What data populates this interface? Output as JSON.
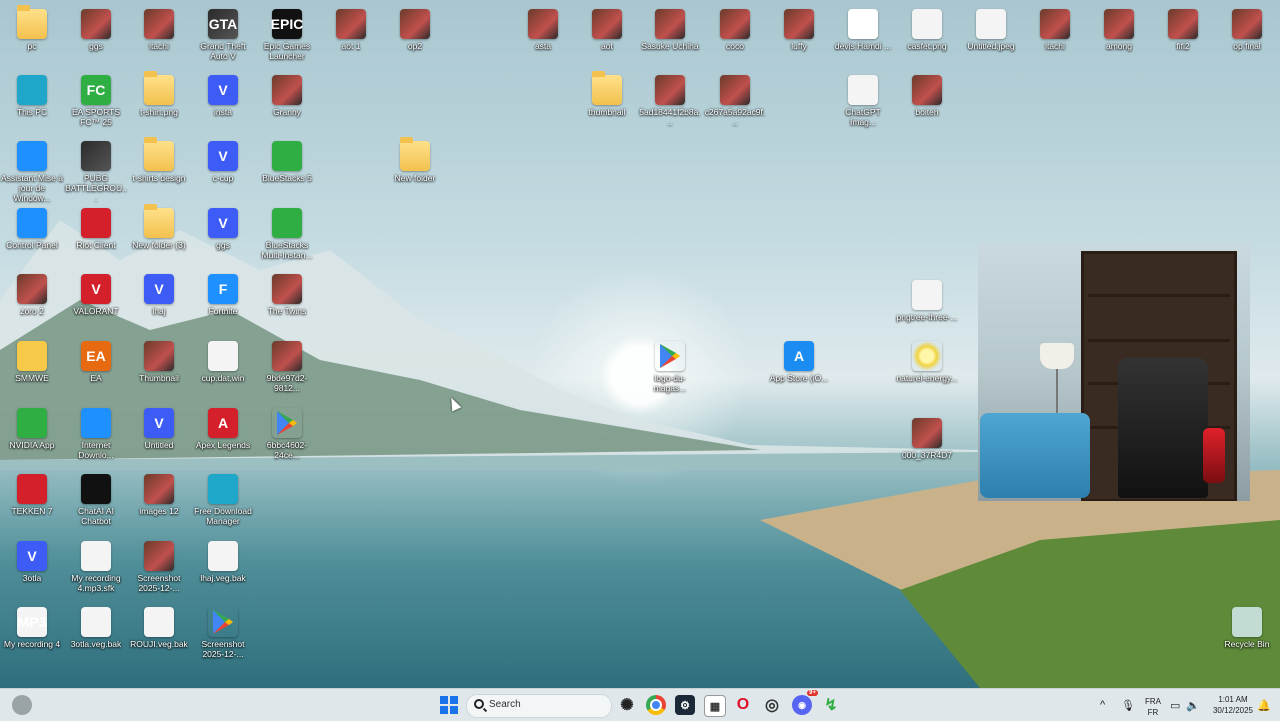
{
  "desktop": {
    "icons": [
      {
        "label": "pc",
        "glyph": "folder-icon",
        "letter": ""
      },
      {
        "label": "ggs",
        "glyph": "photo-icon",
        "letter": ""
      },
      {
        "label": "itachi",
        "glyph": "photo-icon",
        "letter": ""
      },
      {
        "label": "Grand Theft Auto V",
        "glyph": "gta-icon",
        "letter": "GTA"
      },
      {
        "label": "Epic Games Launcher",
        "glyph": "epic-games-icon",
        "letter": "EPIC"
      },
      {
        "label": "aot 1",
        "glyph": "photo-icon",
        "letter": ""
      },
      {
        "label": "op2",
        "glyph": "photo-icon",
        "letter": ""
      },
      {
        "label": "asta",
        "glyph": "photo-icon",
        "letter": ""
      },
      {
        "label": "aot",
        "glyph": "photo-icon",
        "letter": ""
      },
      {
        "label": "Sasuke Uchiha",
        "glyph": "photo-icon",
        "letter": ""
      },
      {
        "label": "coco",
        "glyph": "photo-icon",
        "letter": ""
      },
      {
        "label": "luffy",
        "glyph": "photo-icon",
        "letter": ""
      },
      {
        "label": "devis Hamdi ...",
        "glyph": "pdf-icon",
        "letter": "PDF"
      },
      {
        "label": "casfet.png",
        "glyph": "image-file-icon",
        "letter": ""
      },
      {
        "label": "Untitled.jpeg",
        "glyph": "image-file-icon",
        "letter": ""
      },
      {
        "label": "itachi",
        "glyph": "photo-icon",
        "letter": ""
      },
      {
        "label": "among",
        "glyph": "photo-icon",
        "letter": ""
      },
      {
        "label": "fifi2",
        "glyph": "photo-icon",
        "letter": ""
      },
      {
        "label": "op final",
        "glyph": "photo-icon",
        "letter": ""
      },
      {
        "label": "This PC",
        "glyph": "this-pc-icon",
        "letter": ""
      },
      {
        "label": "EA SPORTS FC™ 25",
        "glyph": "ea-fc-icon",
        "letter": "FC"
      },
      {
        "label": "t-shirt.png",
        "glyph": "folder-icon",
        "letter": ""
      },
      {
        "label": "insta",
        "glyph": "v-app-icon",
        "letter": "V"
      },
      {
        "label": "Granny",
        "glyph": "photo-icon",
        "letter": ""
      },
      {
        "label": "thumbnail",
        "glyph": "folder-icon",
        "letter": ""
      },
      {
        "label": "5ad18441f2b8a...",
        "glyph": "photo-icon",
        "letter": ""
      },
      {
        "label": "c267a5a92ac9f...",
        "glyph": "photo-icon",
        "letter": ""
      },
      {
        "label": "ChatGPT Imag...",
        "glyph": "image-file-icon",
        "letter": ""
      },
      {
        "label": "boiteh",
        "glyph": "photo-icon",
        "letter": ""
      },
      {
        "label": "Assistant Mise à jour de Window...",
        "glyph": "windows-icon",
        "letter": ""
      },
      {
        "label": "PUBG BATTLEGROU...",
        "glyph": "pubg-icon",
        "letter": ""
      },
      {
        "label": "t-shirts design",
        "glyph": "folder-icon",
        "letter": ""
      },
      {
        "label": "c-cup",
        "glyph": "v-app-icon",
        "letter": "V"
      },
      {
        "label": "BlueStacks 5",
        "glyph": "bluestacks-icon",
        "letter": ""
      },
      {
        "label": "New folder",
        "glyph": "folder-icon",
        "letter": ""
      },
      {
        "label": "Control Panel",
        "glyph": "control-panel-icon",
        "letter": ""
      },
      {
        "label": "Riot Client",
        "glyph": "riot-icon",
        "letter": ""
      },
      {
        "label": "New folder (3)",
        "glyph": "folder-icon",
        "letter": ""
      },
      {
        "label": "ggs",
        "glyph": "v-app-icon",
        "letter": "V"
      },
      {
        "label": "BlueStacks Multi-Instan...",
        "glyph": "bluestacks-multi-icon",
        "letter": ""
      },
      {
        "label": "zoro 2",
        "glyph": "photo-icon",
        "letter": ""
      },
      {
        "label": "VALORANT",
        "glyph": "valorant-icon",
        "letter": "V"
      },
      {
        "label": "lhaj",
        "glyph": "v-app-icon",
        "letter": "V"
      },
      {
        "label": "Fortnite",
        "glyph": "fortnite-icon",
        "letter": "F"
      },
      {
        "label": "The Twins",
        "glyph": "photo-icon",
        "letter": ""
      },
      {
        "label": "pngtree-three-...",
        "glyph": "image-file-icon",
        "letter": ""
      },
      {
        "label": "SMMWE",
        "glyph": "smmwe-icon",
        "letter": ""
      },
      {
        "label": "EA",
        "glyph": "ea-icon",
        "letter": "EA"
      },
      {
        "label": "Thumbnail",
        "glyph": "photo-icon",
        "letter": ""
      },
      {
        "label": "cup.dat.win",
        "glyph": "file-icon",
        "letter": ""
      },
      {
        "label": "9bde97d2-9812...",
        "glyph": "photo-icon",
        "letter": ""
      },
      {
        "label": "logo-du-magas...",
        "glyph": "google-play-icon",
        "letter": ""
      },
      {
        "label": "App Store (iO...",
        "glyph": "app-store-icon",
        "letter": "A"
      },
      {
        "label": "naturel-energy...",
        "glyph": "sun-icon",
        "letter": ""
      },
      {
        "label": "NVIDIA App",
        "glyph": "nvidia-icon",
        "letter": ""
      },
      {
        "label": "Internet Downlo...",
        "glyph": "idm-icon",
        "letter": ""
      },
      {
        "label": "Untitled",
        "glyph": "v-app-icon",
        "letter": "V"
      },
      {
        "label": "Apex Legends",
        "glyph": "apex-icon",
        "letter": "A"
      },
      {
        "label": "6bbc4602-24ce...",
        "glyph": "google-play-icon",
        "letter": ""
      },
      {
        "label": "000_37R4D7",
        "glyph": "photo-icon",
        "letter": ""
      },
      {
        "label": "TEKKEN 7",
        "glyph": "tekken-icon",
        "letter": ""
      },
      {
        "label": "ChatAI AI Chatbot",
        "glyph": "chatbot-icon",
        "letter": ""
      },
      {
        "label": "images 12",
        "glyph": "photo-icon",
        "letter": ""
      },
      {
        "label": "Free Download Manager",
        "glyph": "fdm-icon",
        "letter": ""
      },
      {
        "label": "3otla",
        "glyph": "v-app-icon",
        "letter": "V"
      },
      {
        "label": "My recording 4.mp3.sfk",
        "glyph": "file-icon",
        "letter": ""
      },
      {
        "label": "Screenshot 2025-12-...",
        "glyph": "photo-icon",
        "letter": ""
      },
      {
        "label": "lhaj.veg.bak",
        "glyph": "file-icon",
        "letter": ""
      },
      {
        "label": "My recording 4",
        "glyph": "mp3-icon",
        "letter": "MP3"
      },
      {
        "label": "3otla.veg.bak",
        "glyph": "file-icon",
        "letter": ""
      },
      {
        "label": "ROUJI.veg.bak",
        "glyph": "file-icon",
        "letter": ""
      },
      {
        "label": "Screenshot 2025-12-...",
        "glyph": "google-play-icon",
        "letter": ""
      },
      {
        "label": "Recycle Bin",
        "glyph": "recycle-bin-icon",
        "letter": ""
      }
    ]
  },
  "taskbar": {
    "search_placeholder": "Search",
    "tray": {
      "lang_top": "FRA",
      "lang_bottom": "FR",
      "time": "1:01 AM",
      "date": "30/12/2025"
    },
    "chevron": "^",
    "discord_badge": "9+"
  },
  "colors": {
    "accent": "#3d5bf5",
    "taskbar": "#dfe7ea"
  }
}
